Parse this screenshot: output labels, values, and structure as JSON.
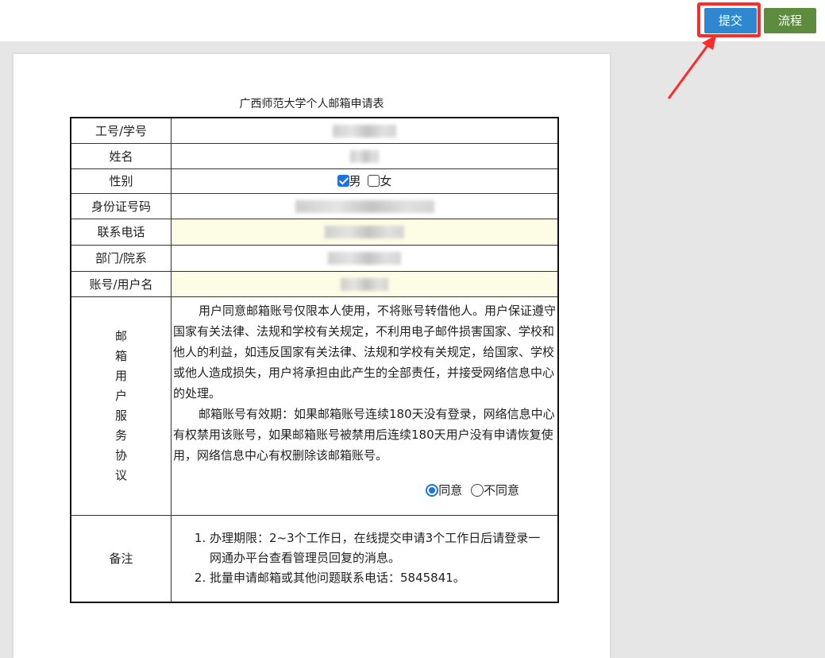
{
  "toolbar": {
    "submit_label": "提交",
    "flow_label": "流程"
  },
  "form": {
    "title": "广西师范大学个人邮箱申请表",
    "rows": [
      {
        "label": "工号/学号"
      },
      {
        "label": "姓名"
      },
      {
        "label": "性别"
      },
      {
        "label": "身份证号码"
      },
      {
        "label": "联系电话"
      },
      {
        "label": "部门/院系"
      },
      {
        "label": "账号/用户名"
      }
    ],
    "gender": {
      "male": "男",
      "female": "女",
      "selected": "男"
    },
    "agreement": {
      "label": "邮箱用户服务协议",
      "label_chars": [
        "邮",
        "箱",
        "用",
        "户",
        "服",
        "务",
        "协",
        "议"
      ],
      "paragraph1": "用户同意邮箱账号仅限本人使用，不将账号转借他人。用户保证遵守国家有关法律、法规和学校有关规定，不利用电子邮件损害国家、学校和他人的利益，如违反国家有关法律、法规和学校有关规定，给国家、学校或他人造成损失，用户将承担由此产生的全部责任，并接受网络信息中心的处理。",
      "paragraph2": "邮箱账号有效期：如果邮箱账号连续180天没有登录，网络信息中心有权禁用该账号，如果邮箱账号被禁用后连续180天用户没有申请恢复使用，网络信息中心有权删除该邮箱账号。",
      "agree": "同意",
      "disagree": "不同意",
      "selected": "同意"
    },
    "notes": {
      "label": "备注",
      "items": [
        "办理期限：2~3个工作日，在线提交申请3个工作日后请登录一网通办平台查看管理员回复的消息。",
        "批量申请邮箱或其他问题联系电话：5845841。"
      ]
    }
  },
  "colors": {
    "submit": "#2f87d0",
    "flow": "#5e8c3e",
    "highlight": "#ff2a2a",
    "input_bg": "#fdfde6"
  }
}
